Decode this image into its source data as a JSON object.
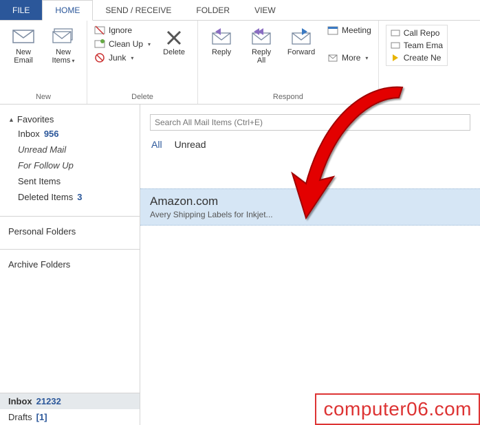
{
  "tabs": {
    "file": "FILE",
    "home": "HOME",
    "send_receive": "SEND / RECEIVE",
    "folder": "FOLDER",
    "view": "VIEW"
  },
  "ribbon": {
    "new": {
      "label": "New",
      "new_email": "New\nEmail",
      "new_items": "New\nItems"
    },
    "delete": {
      "label": "Delete",
      "ignore": "Ignore",
      "clean_up": "Clean Up",
      "junk": "Junk",
      "delete": "Delete"
    },
    "respond": {
      "label": "Respond",
      "reply": "Reply",
      "reply_all": "Reply\nAll",
      "forward": "Forward",
      "meeting": "Meeting",
      "more": "More"
    },
    "quick_steps": {
      "call_repo": "Call Repo",
      "team_ema": "Team Ema",
      "create_ne": "Create Ne"
    }
  },
  "sidebar": {
    "favorites": "Favorites",
    "inbox": "Inbox",
    "inbox_count": "956",
    "unread_mail": "Unread Mail",
    "follow_up": "For Follow Up",
    "sent": "Sent Items",
    "deleted": "Deleted Items",
    "deleted_count": "3",
    "personal": "Personal Folders",
    "archive": "Archive Folders",
    "inbox2": "Inbox",
    "inbox2_count": "21232",
    "drafts": "Drafts",
    "drafts_count": "[1]"
  },
  "search": {
    "placeholder": "Search All Mail Items (Ctrl+E)"
  },
  "filters": {
    "all": "All",
    "unread": "Unread"
  },
  "message": {
    "sender": "Amazon.com",
    "subject": "Avery Shipping Labels for Inkjet..."
  },
  "watermark": "computer06.com"
}
